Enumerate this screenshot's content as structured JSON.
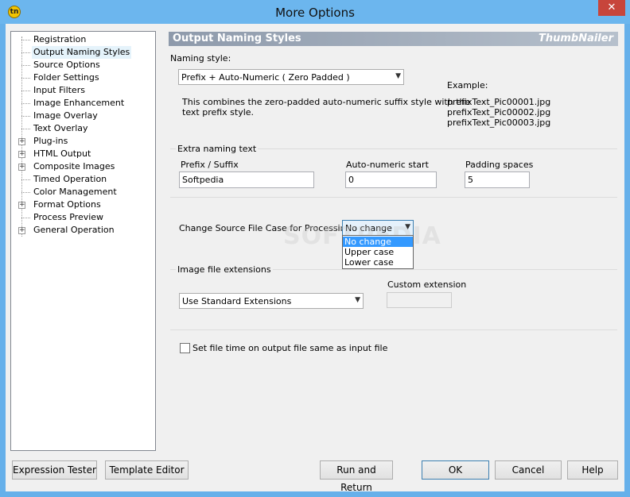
{
  "window": {
    "title": "More Options",
    "app_icon": "tn",
    "close_glyph": "✕"
  },
  "tree": {
    "items": [
      {
        "label": "Registration",
        "expandable": false
      },
      {
        "label": "Output Naming Styles",
        "expandable": false,
        "selected": true
      },
      {
        "label": "Source Options",
        "expandable": false
      },
      {
        "label": "Folder Settings",
        "expandable": false
      },
      {
        "label": "Input Filters",
        "expandable": false
      },
      {
        "label": "Image Enhancement",
        "expandable": false
      },
      {
        "label": "Image Overlay",
        "expandable": false
      },
      {
        "label": "Text Overlay",
        "expandable": false
      },
      {
        "label": "Plug-ins",
        "expandable": true
      },
      {
        "label": "HTML Output",
        "expandable": true
      },
      {
        "label": "Composite Images",
        "expandable": true
      },
      {
        "label": "Timed Operation",
        "expandable": false
      },
      {
        "label": "Color Management",
        "expandable": false
      },
      {
        "label": "Format Options",
        "expandable": true
      },
      {
        "label": "Process Preview",
        "expandable": false
      },
      {
        "label": "General Operation",
        "expandable": true
      }
    ],
    "expander_glyph": "+"
  },
  "header": {
    "title": "Output Naming Styles",
    "brand": "ThumbNailer"
  },
  "naming": {
    "label": "Naming style:",
    "value": "Prefix + Auto-Numeric ( Zero Padded )",
    "description_line1": "This combines the zero-padded auto-numeric suffix style with the",
    "description_line2": "text prefix style.",
    "example_label": "Example:",
    "examples": [
      "prefixText_Pic00001.jpg",
      "prefixText_Pic00002.jpg",
      "prefixText_Pic00003.jpg"
    ]
  },
  "extra": {
    "legend": "Extra naming text",
    "prefix_label": "Prefix / Suffix",
    "prefix_value": "Softpedia",
    "autonum_label": "Auto-numeric start",
    "autonum_value": "0",
    "padding_label": "Padding spaces",
    "padding_value": "5"
  },
  "case": {
    "label": "Change Source File Case for Processing:",
    "value": "No change",
    "options": [
      "No change",
      "Upper case",
      "Lower case"
    ],
    "highlighted_index": 0
  },
  "extensions": {
    "legend": "Image file extensions",
    "value": "Use Standard Extensions",
    "custom_label": "Custom extension",
    "custom_value": ""
  },
  "filetime": {
    "label": "Set file time on output file same as input file",
    "checked": false
  },
  "buttons": {
    "expression_tester": "Expression Tester",
    "template_editor": "Template Editor",
    "run_and_return": "Run and Return",
    "ok": "OK",
    "cancel": "Cancel",
    "help": "Help"
  },
  "icons": {
    "dropdown_arrow": "▼",
    "dropdown_arrow_name": "chevron-down-icon"
  },
  "watermark": "SOFTPEDIA"
}
